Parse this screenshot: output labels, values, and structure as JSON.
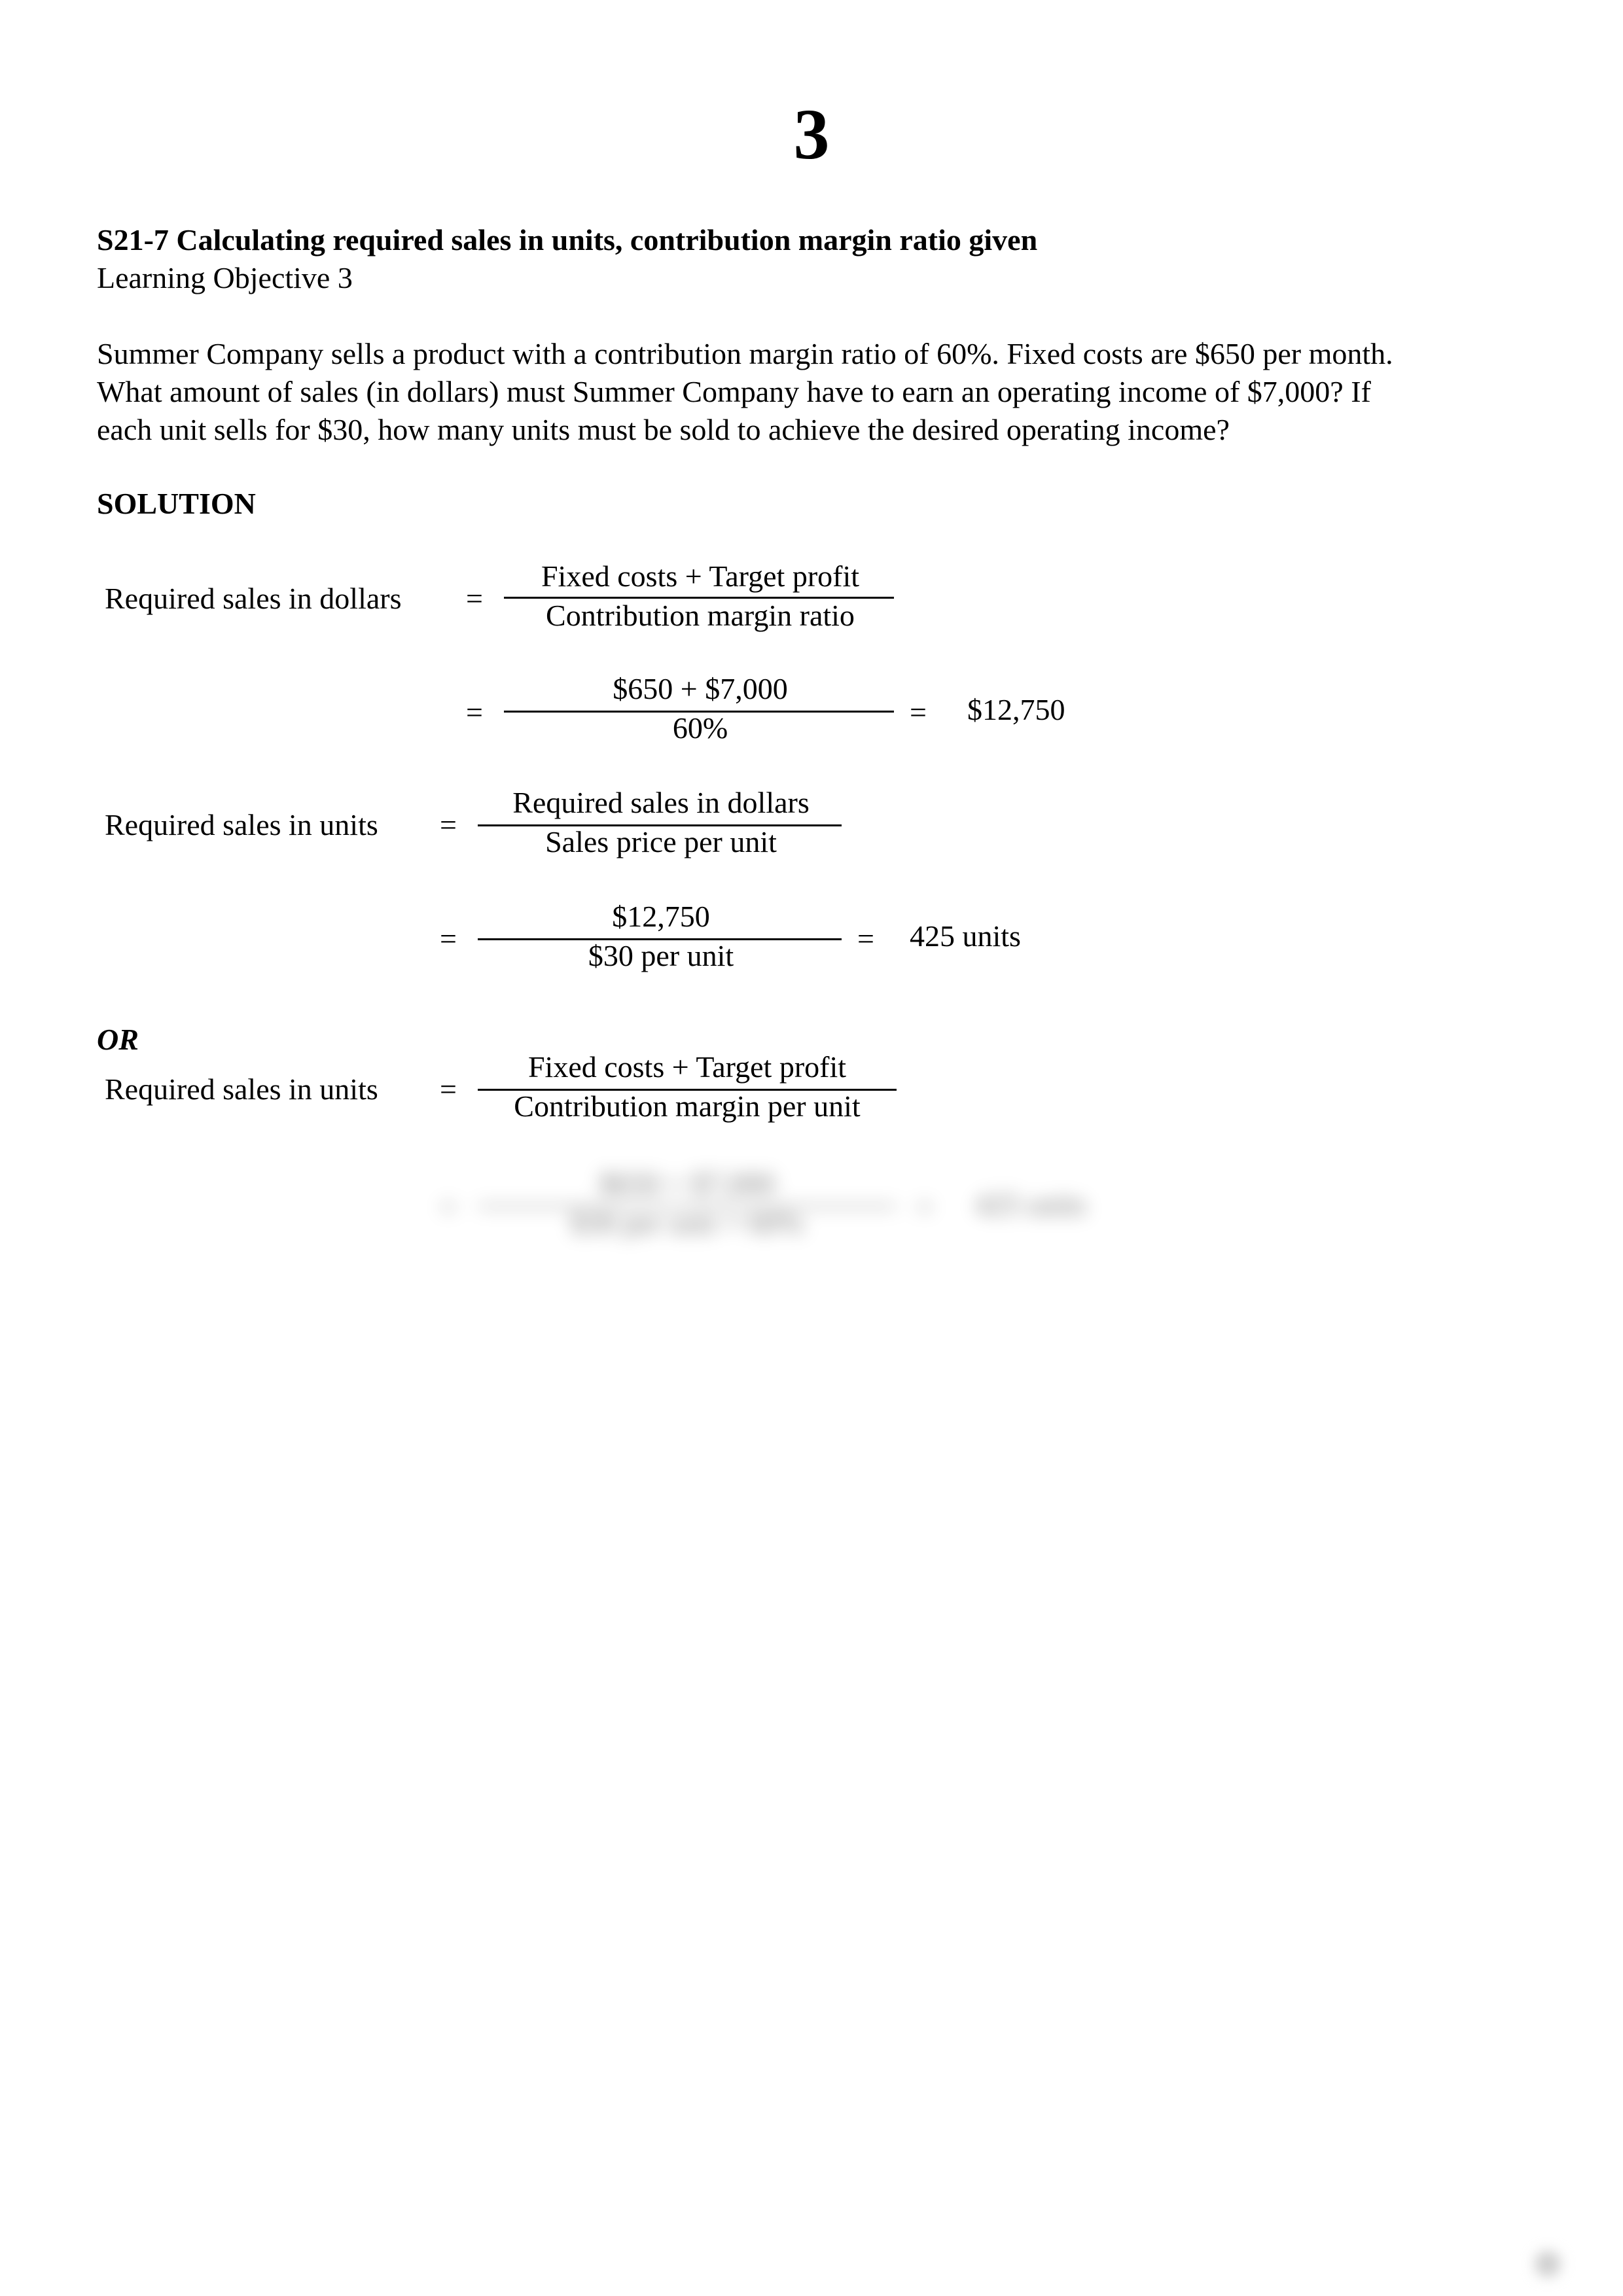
{
  "page": {
    "number": "3"
  },
  "exercise": {
    "title": "S21-7 Calculating required sales in units, contribution margin ratio given",
    "learning_objective": "Learning Objective 3",
    "problem_lines": [
      "Summer Company sells a product with a contribution margin ratio of 60%. Fixed costs are $650 per month.",
      "What amount of sales (in dollars) must Summer Company have to earn an operating income of $7,000? If",
      "each unit sells for $30, how many units must be sold to achieve the desired operating income?"
    ]
  },
  "solution": {
    "heading": "SOLUTION",
    "equals": "=",
    "formula1": {
      "label": "Required sales in dollars",
      "numerator": "Fixed costs + Target profit",
      "denominator": "Contribution margin ratio"
    },
    "calc1": {
      "numerator": "$650 + $7,000",
      "denominator": "60%",
      "result": "$12,750"
    },
    "formula2": {
      "label": "Required sales in units",
      "numerator": "Required sales in dollars",
      "denominator": "Sales price per unit"
    },
    "calc2": {
      "numerator": "$12,750",
      "denominator": "$30 per unit",
      "result": "425 units"
    },
    "or_label": "OR",
    "formula3": {
      "label": "Required sales in units",
      "numerator": "Fixed costs + Target profit",
      "denominator": "Contribution margin per unit"
    },
    "calc3_blurred": {
      "numerator": "$650 + $7,000",
      "denominator": "$30 per unit × 60%",
      "result": "425 units"
    }
  }
}
